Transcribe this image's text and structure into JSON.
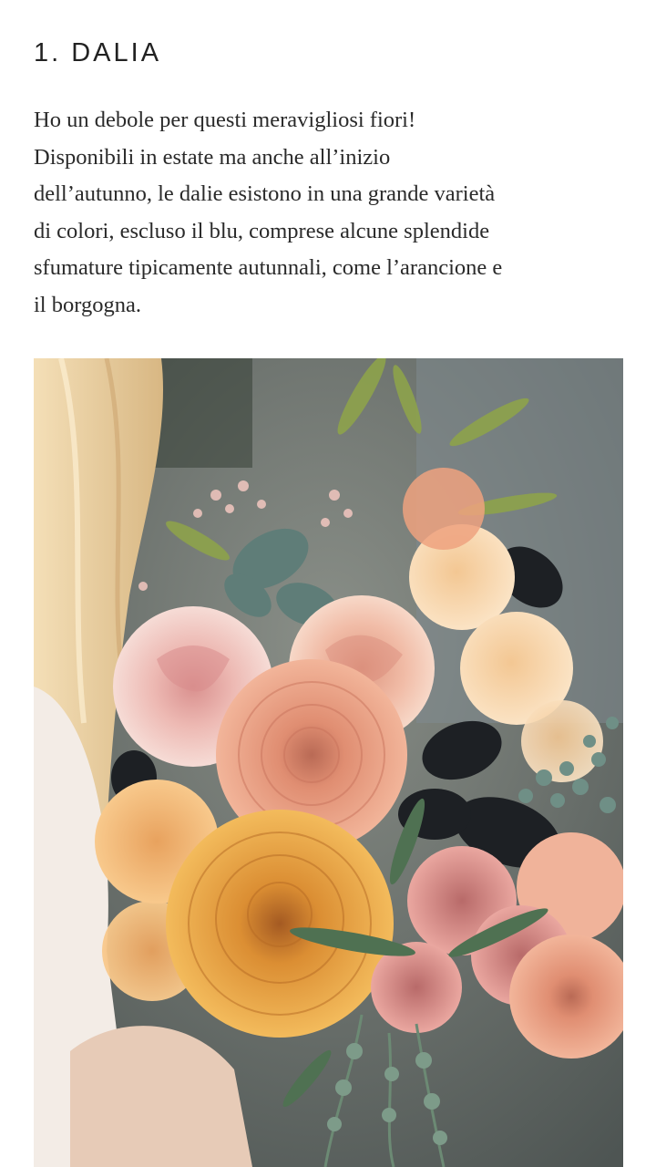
{
  "article": {
    "heading": "1. DALIA",
    "paragraph_lines": [
      "Ho un debole per questi meravigliosi fiori!",
      "Disponibili in estate ma anche all’inizio",
      "dell’autunno, le dalie esistono in una grande varietà",
      "di colori, escluso il blu, comprese alcune splendide",
      "sfumature tipicamente autunnali, come l’arancione e",
      "il borgogna."
    ]
  },
  "photo": {
    "subject": "bridal-bouquet-photo",
    "colors": {
      "background": "#6b7170",
      "hair": "#e9cfa4",
      "dress": "#f3ece6",
      "peach_rose": "#f1b9a8",
      "blush_rose": "#f0c8c4",
      "cream_rose": "#f7d3a6",
      "coral_dahlia": "#e5987a",
      "mustard_dahlia": "#e7a13f",
      "dusty_pink_rose": "#d98a82",
      "dark_foliage": "#1d2024",
      "eucalyptus": "#5f7d78",
      "olive_leaf": "#8ea34b"
    }
  }
}
